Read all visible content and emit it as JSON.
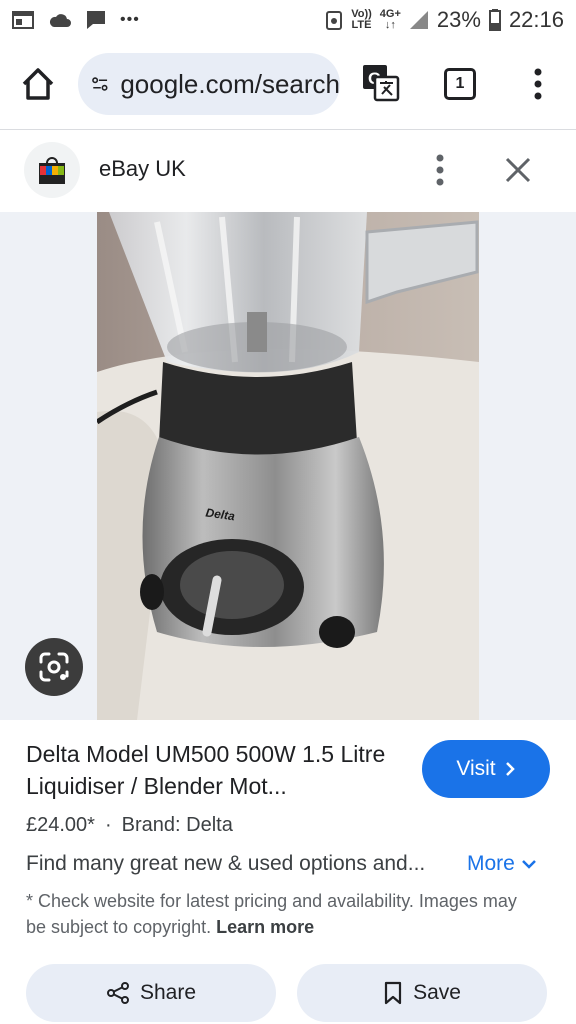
{
  "status_bar": {
    "volte_top": "Vo))",
    "volte_bottom": "LTE",
    "network_top": "4G+",
    "network_bottom": "↓↑",
    "battery": "23%",
    "time": "22:16",
    "overflow": "•••"
  },
  "toolbar": {
    "url": "google.com/search",
    "tab_count": "1"
  },
  "source": {
    "name": "eBay UK"
  },
  "product": {
    "title": "Delta Model UM500 500W 1.5 Litre Liquidiser / Blender Mot...",
    "visit_label": "Visit",
    "price": "£24.00*",
    "separator": "·",
    "brand": "Brand: Delta",
    "description": "Find many great new & used options and...",
    "more_label": "More",
    "disclaimer": "* Check website for latest pricing and availability. Images may be subject to copyright.",
    "learn_more": "Learn more",
    "share_label": "Share",
    "save_label": "Save",
    "image_brand": "Delta"
  },
  "colors": {
    "accent": "#1a73e8",
    "pill_bg": "#e8edf6"
  }
}
